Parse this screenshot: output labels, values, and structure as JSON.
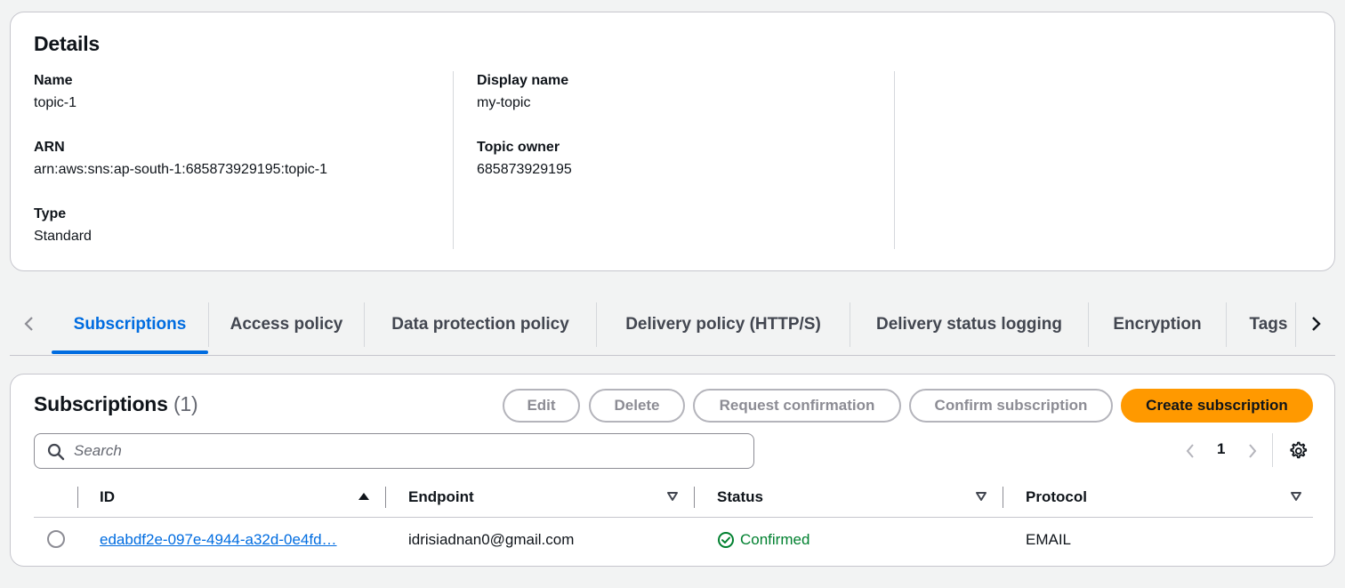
{
  "details": {
    "title": "Details",
    "name_label": "Name",
    "name_value": "topic-1",
    "arn_label": "ARN",
    "arn_value": "arn:aws:sns:ap-south-1:685873929195:topic-1",
    "type_label": "Type",
    "type_value": "Standard",
    "display_name_label": "Display name",
    "display_name_value": "my-topic",
    "owner_label": "Topic owner",
    "owner_value": "685873929195"
  },
  "tabs": [
    {
      "label": "Subscriptions",
      "active": true
    },
    {
      "label": "Access policy"
    },
    {
      "label": "Data protection policy"
    },
    {
      "label": "Delivery policy (HTTP/S)"
    },
    {
      "label": "Delivery status logging"
    },
    {
      "label": "Encryption"
    },
    {
      "label": "Tags"
    }
  ],
  "subscriptions": {
    "title": "Subscriptions",
    "count": "(1)",
    "buttons": {
      "edit": "Edit",
      "delete": "Delete",
      "request_confirmation": "Request confirmation",
      "confirm_subscription": "Confirm subscription",
      "create_subscription": "Create subscription"
    },
    "search_placeholder": "Search",
    "page": "1",
    "columns": [
      "ID",
      "Endpoint",
      "Status",
      "Protocol"
    ],
    "rows": [
      {
        "id": "edabdf2e-097e-4944-a32d-0e4fd…",
        "endpoint": "idrisiadnan0@gmail.com",
        "status": "Confirmed",
        "protocol": "EMAIL"
      }
    ]
  },
  "colors": {
    "accent": "#006ce0",
    "primary_button": "#ff9900",
    "success": "#00802f"
  },
  "icons": [
    "chevron-left-icon",
    "chevron-right-icon",
    "search-icon",
    "settings-gear-icon",
    "sort-ascending-icon",
    "sort-descending-icon",
    "status-check-icon"
  ]
}
